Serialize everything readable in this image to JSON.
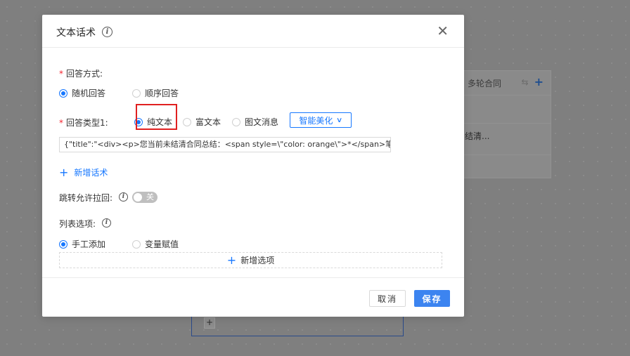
{
  "background": {
    "panel_title": "多轮合同",
    "panel_text": "结清...",
    "node_plus": "+"
  },
  "dialog": {
    "title": "文本话术",
    "close": "✕",
    "answer_mode": {
      "required": "*",
      "label": "回答方式:",
      "options": [
        "随机回答",
        "顺序回答"
      ],
      "selected": "随机回答"
    },
    "answer_type": {
      "required": "*",
      "label": "回答类型1:",
      "options": [
        "纯文本",
        "富文本",
        "图文消息"
      ],
      "selected": "纯文本",
      "beautify_label": "智能美化",
      "content_value": "{\"title\":\"<div><p>您当前未结清合同总结：<span style=\\\"color: orange\\\">*</span>笔"
    },
    "add_script_label": "新增话术",
    "allow_pullback": {
      "label": "跳转允许拉回:",
      "toggle_text": "关",
      "enabled": false
    },
    "list_options": {
      "label": "列表选项:",
      "options": [
        "手工添加",
        "变量赋值"
      ],
      "selected": "手工添加",
      "add_option_label": "新增选项"
    },
    "footer": {
      "cancel_label": "取消",
      "save_label": "保存"
    }
  },
  "colors": {
    "primary": "#1677ff",
    "required": "#f5222d",
    "highlight": "#e02020",
    "save_button": "#3c84f0"
  }
}
